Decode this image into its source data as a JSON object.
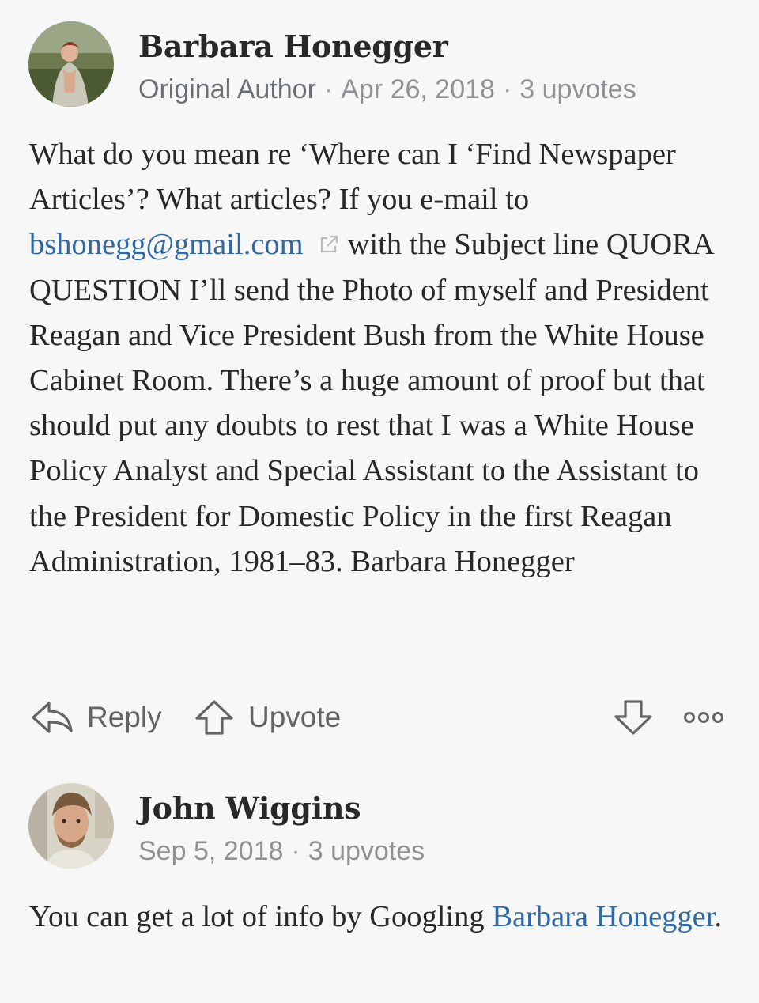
{
  "comments": [
    {
      "author": "Barbara Honegger",
      "badge": "Original Author",
      "date": "Apr 26, 2018",
      "upvotes": "3 upvotes",
      "avatar_icon": "user-photo-outdoor-garden",
      "body": {
        "before_link": "What do you mean re ‘Where can I ‘Find Newspaper Articles’? What articles? If you e-mail to ",
        "link": "bshonegg@gmail.com",
        "after_link": "with the Subject line QUORA QUESTION I’ll send the Photo of myself and President Reagan and Vice President Bush from the White House Cabinet Room. There’s a huge amount of proof but that should put any doubts to rest that I was a White House Policy Analyst and Special Assistant to the Assistant to the President for Domestic Policy in the first Reagan Administration, 1981–83. Barbara Honegger"
      },
      "actions": {
        "reply": "Reply",
        "upvote": "Upvote"
      }
    },
    {
      "author": "John Wiggins",
      "date": "Sep 5, 2018",
      "upvotes": "3 upvotes",
      "avatar_icon": "user-photo-man",
      "body": {
        "before_link": "You can get a lot of info by Googling ",
        "link": "Barbara Honegger",
        "after_link": "."
      }
    }
  ],
  "colors": {
    "link": "#2e69a3",
    "meta": "#8f9194",
    "text": "#282829",
    "background": "#f7f7f7"
  }
}
